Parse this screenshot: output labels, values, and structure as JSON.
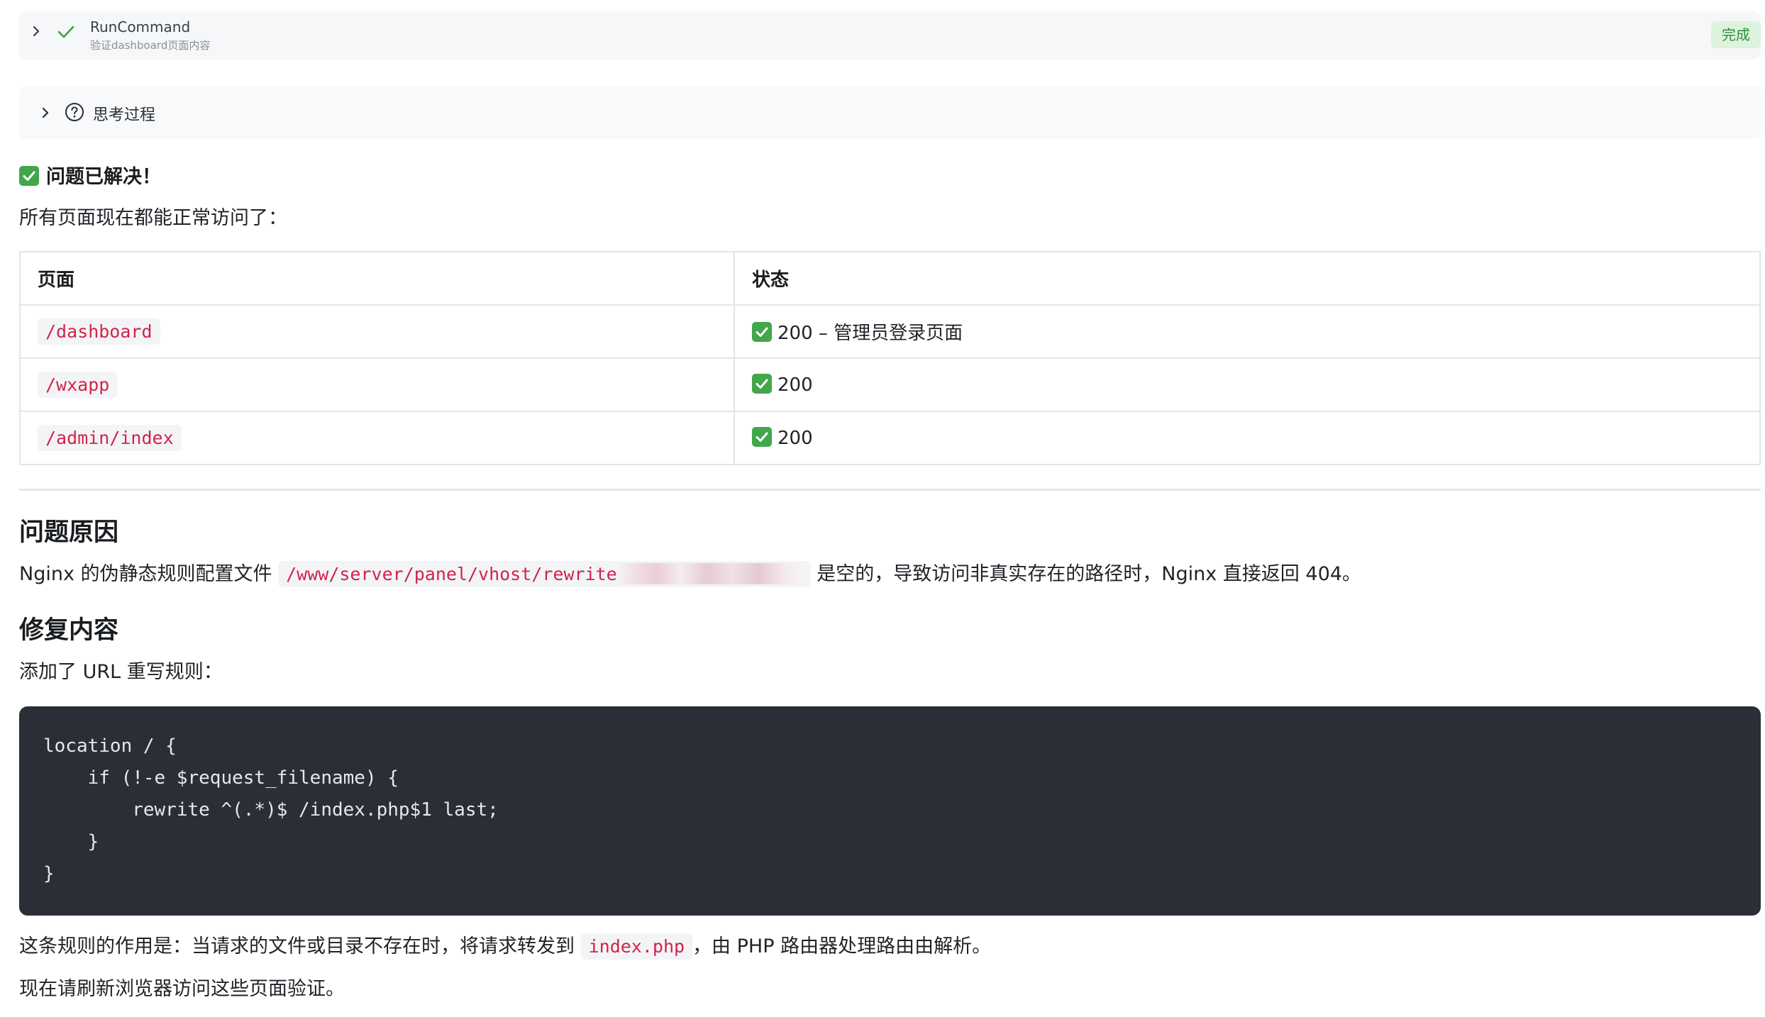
{
  "command": {
    "title": "RunCommand",
    "subtitle": "验证dashboard页面内容",
    "status": "完成",
    "status_color": "#2f8f3a",
    "icons": [
      "chevron-right-icon",
      "check-icon"
    ]
  },
  "thinking": {
    "label": "思考过程",
    "icons": [
      "chevron-right-icon",
      "question-circle-icon"
    ]
  },
  "result": {
    "heading": "问题已解决！",
    "intro": "所有页面现在都能正常访问了：",
    "table": {
      "headers": [
        "页面",
        "状态"
      ],
      "rows": [
        {
          "page": "/dashboard",
          "status": "200 – 管理员登录页面"
        },
        {
          "page": "/wxapp",
          "status": "200"
        },
        {
          "page": "/admin/index",
          "status": "200"
        }
      ]
    }
  },
  "cause": {
    "heading": "问题原因",
    "text_before": "Nginx 的伪静态规则配置文件",
    "path": "/www/server/panel/vhost/rewrite",
    "text_after": "是空的，导致访问非真实存在的路径时，Nginx 直接返回 404。"
  },
  "fix": {
    "heading": "修复内容",
    "intro": "添加了 URL 重写规则：",
    "code": "location / {\n    if (!-e $request_filename) {\n        rewrite ^(.*)$ /index.php$1 last;\n    }\n}",
    "explain_before": "这条规则的作用是：当请求的文件或目录不存在时，将请求转发到",
    "explain_code": "index.php",
    "explain_after": "，由 PHP 路由器处理路由由解析。",
    "closing": "现在请刷新浏览器访问这些页面验证。"
  },
  "colors": {
    "accent_red": "#d1244b",
    "check_green": "#42a64b",
    "code_bg": "#2b2e36"
  }
}
